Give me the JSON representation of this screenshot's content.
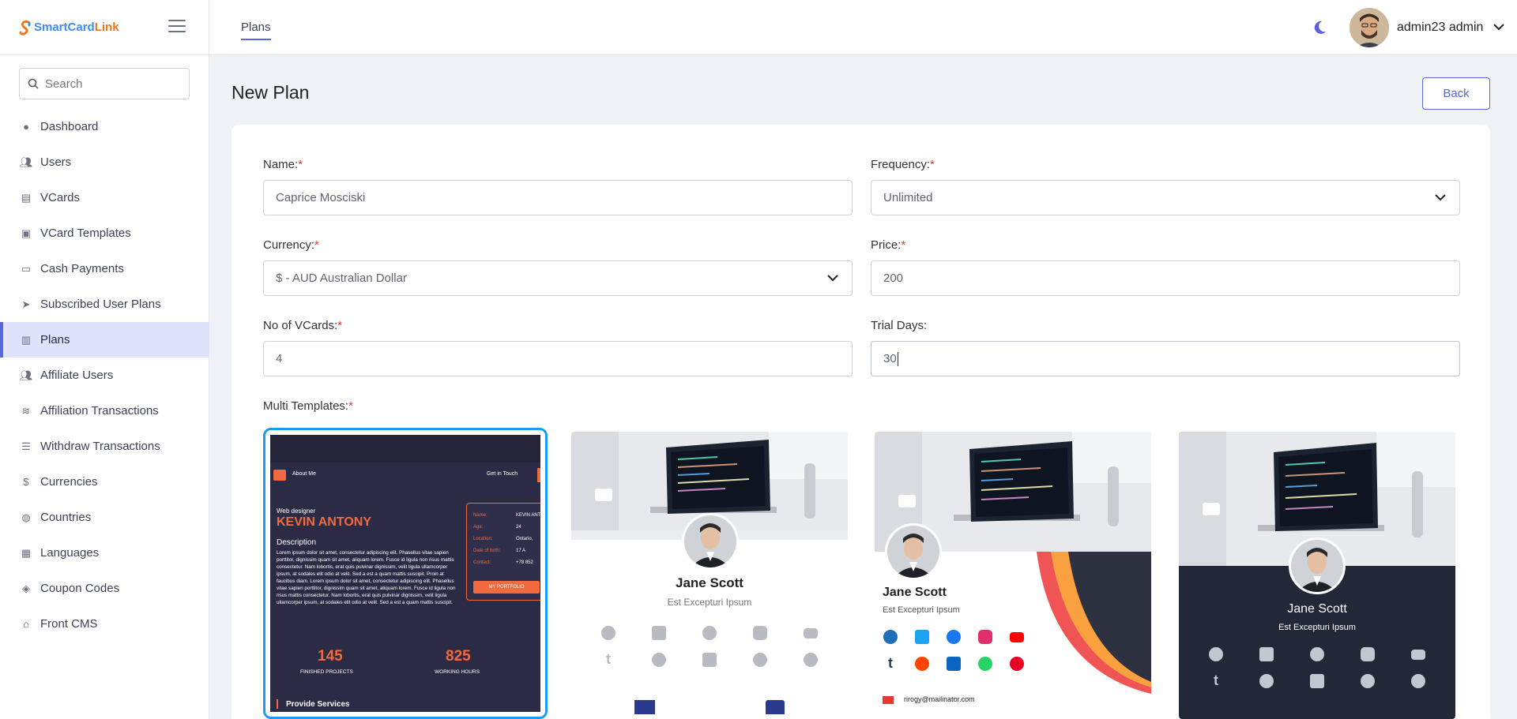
{
  "brand": {
    "part1": "SmartCard",
    "part2": "Link"
  },
  "search": {
    "placeholder": "Search"
  },
  "nav": [
    {
      "label": "Dashboard",
      "icon": "dashboard-icon"
    },
    {
      "label": "Users",
      "icon": "users-icon"
    },
    {
      "label": "VCards",
      "icon": "vcard-icon"
    },
    {
      "label": "VCard Templates",
      "icon": "vcard-template-icon"
    },
    {
      "label": "Cash Payments",
      "icon": "cash-icon"
    },
    {
      "label": "Subscribed User Plans",
      "icon": "paper-plane-icon"
    },
    {
      "label": "Plans",
      "icon": "plans-icon",
      "active": true
    },
    {
      "label": "Affiliate Users",
      "icon": "affiliate-users-icon"
    },
    {
      "label": "Affiliation Transactions",
      "icon": "coins-icon"
    },
    {
      "label": "Withdraw Transactions",
      "icon": "list-icon"
    },
    {
      "label": "Currencies",
      "icon": "dollar-icon"
    },
    {
      "label": "Countries",
      "icon": "globe-icon"
    },
    {
      "label": "Languages",
      "icon": "language-icon"
    },
    {
      "label": "Coupon Codes",
      "icon": "tag-icon"
    },
    {
      "label": "Front CMS",
      "icon": "home-icon"
    }
  ],
  "header": {
    "breadcrumb": "Plans",
    "user_name": "admin23 admin"
  },
  "page": {
    "title": "New Plan",
    "back_label": "Back"
  },
  "form": {
    "name_label": "Name:",
    "name_value": "Caprice Mosciski",
    "frequency_label": "Frequency:",
    "frequency_value": "Unlimited",
    "currency_label": "Currency:",
    "currency_value": "$ - AUD Australian Dollar",
    "price_label": "Price:",
    "price_value": "200",
    "vcards_label": "No of VCards:",
    "vcards_value": "4",
    "trial_label": "Trial Days:",
    "trial_value": "30",
    "templates_label": "Multi Templates:",
    "required_mark": "*"
  },
  "templates": {
    "t1": {
      "about": "About Me",
      "get_in_touch": "Get in Touch",
      "role": "Web designer",
      "name": "KEVIN ANTONY",
      "desc_title": "Description",
      "desc_text": "Lorem ipsum dolor sit amet, consectetur adipiscing elit. Phasellus vitae sapien porttitor, dignissim quam sit amet, aliquam lorem. Fusce id ligula non risus mattis consectetur. Nam lobortis, erat quis pulvinar dignissim, velit ligula ullamcorper ipsum, at sodales elit odio at velit. Sed a est a quam mattis suscipit. Proin at faucibus diam. Lorem ipsum dolor sit amet, consectetur adipiscing elit. Phasellus vitae sapien porttitor, dignissim quam sit amet, aliquam lorem. Fusce id ligula non risus mattis consectetur. Nam lobortis, erat quis pulvinar dignissim, velit ligula ullamcorper ipsum, at sodales elit odio at velit. Sed a est a quam mattis suscipit.",
      "info": [
        {
          "k": "Name:",
          "v": "KEVIN ANTO"
        },
        {
          "k": "Age:",
          "v": "24"
        },
        {
          "k": "Location:",
          "v": "Ontario,"
        },
        {
          "k": "Date of birth:",
          "v": "17 A"
        },
        {
          "k": "Contact:",
          "v": "+78 852"
        }
      ],
      "portfolio": "MY PORTFOLIO",
      "stat1_value": "145",
      "stat1_label": "FINISHED PROJECTS",
      "stat2_value": "825",
      "stat2_label": "WORKING HOURS",
      "services": "Provide Services"
    },
    "person_name": "Jane Scott",
    "person_title": "Est Excepturi Ipsum",
    "email": "rirogy@mailinator.com"
  },
  "colors": {
    "accent": "#5867dd",
    "t1_bg": "#2c2b45",
    "t1_orange": "#f26a3d",
    "t4_bg": "#222838",
    "selected_border": "#1d9bf0"
  }
}
